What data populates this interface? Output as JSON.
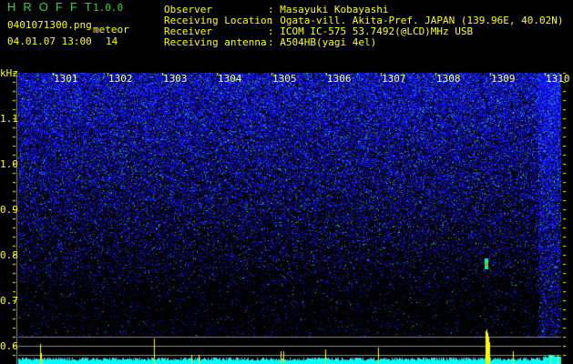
{
  "app": {
    "title": "HROFFT",
    "version": "1.0.0"
  },
  "file": {
    "name": "0401071300.png",
    "datetime": "04.01.07 13:00"
  },
  "meteor": {
    "label": "meteor",
    "count": "14"
  },
  "info": [
    {
      "label": "Observer",
      "value": ": Masayuki Kobayashi"
    },
    {
      "label": "Receiving Location",
      "value": ": Ogata-vill. Akita-Pref. JAPAN (139.96E, 40.02N)"
    },
    {
      "label": "Receiver",
      "value": ": ICOM IC-575 53.7492(@LCD)MHz USB"
    },
    {
      "label": "Receiving antenna",
      "value": ": A504HB(yagi 4el)"
    }
  ],
  "axis": {
    "unit": "kHz",
    "y_labels": [
      "1.1",
      "1.0",
      "0.9",
      "0.8",
      "0.7",
      "0.6"
    ],
    "minutes": [
      "1301",
      "1302",
      "1303",
      "1304",
      "1305",
      "1306",
      "1307",
      "1308",
      "1309",
      "1310"
    ]
  },
  "colors": {
    "text": "#ffff00",
    "title": "#22dd22",
    "noise": "#1a1aff",
    "baseline": "#00ffff",
    "spike": "#ffff00"
  }
}
